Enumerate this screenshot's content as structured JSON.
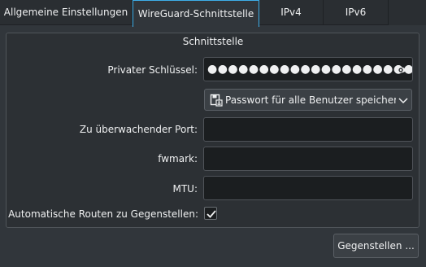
{
  "tabs": [
    {
      "label": "Allgemeine Einstellungen"
    },
    {
      "label": "WireGuard-Schnittstelle",
      "active": true
    },
    {
      "label": "IPv4"
    },
    {
      "label": "IPv6"
    }
  ],
  "group_title": "Schnittstelle",
  "private_key": {
    "label": "Privater Schlüssel:",
    "masked_value": "●●●●●●●●●●●●●●●●●●●●●●"
  },
  "password_storage": {
    "selected": "Passwort für alle Benutzer speichern"
  },
  "listen_port": {
    "label": "Zu überwachender Port:",
    "value": ""
  },
  "fwmark": {
    "label": "fwmark:",
    "value": ""
  },
  "mtu": {
    "label": "MTU:",
    "value": ""
  },
  "auto_routes": {
    "label": "Automatische Routen zu Gegenstellen:",
    "checked": true
  },
  "peers_button": {
    "label": "Gegenstellen ..."
  },
  "colors": {
    "accent": "#3daee9",
    "window_bg": "#31363b",
    "field_bg": "#1b1e20"
  }
}
